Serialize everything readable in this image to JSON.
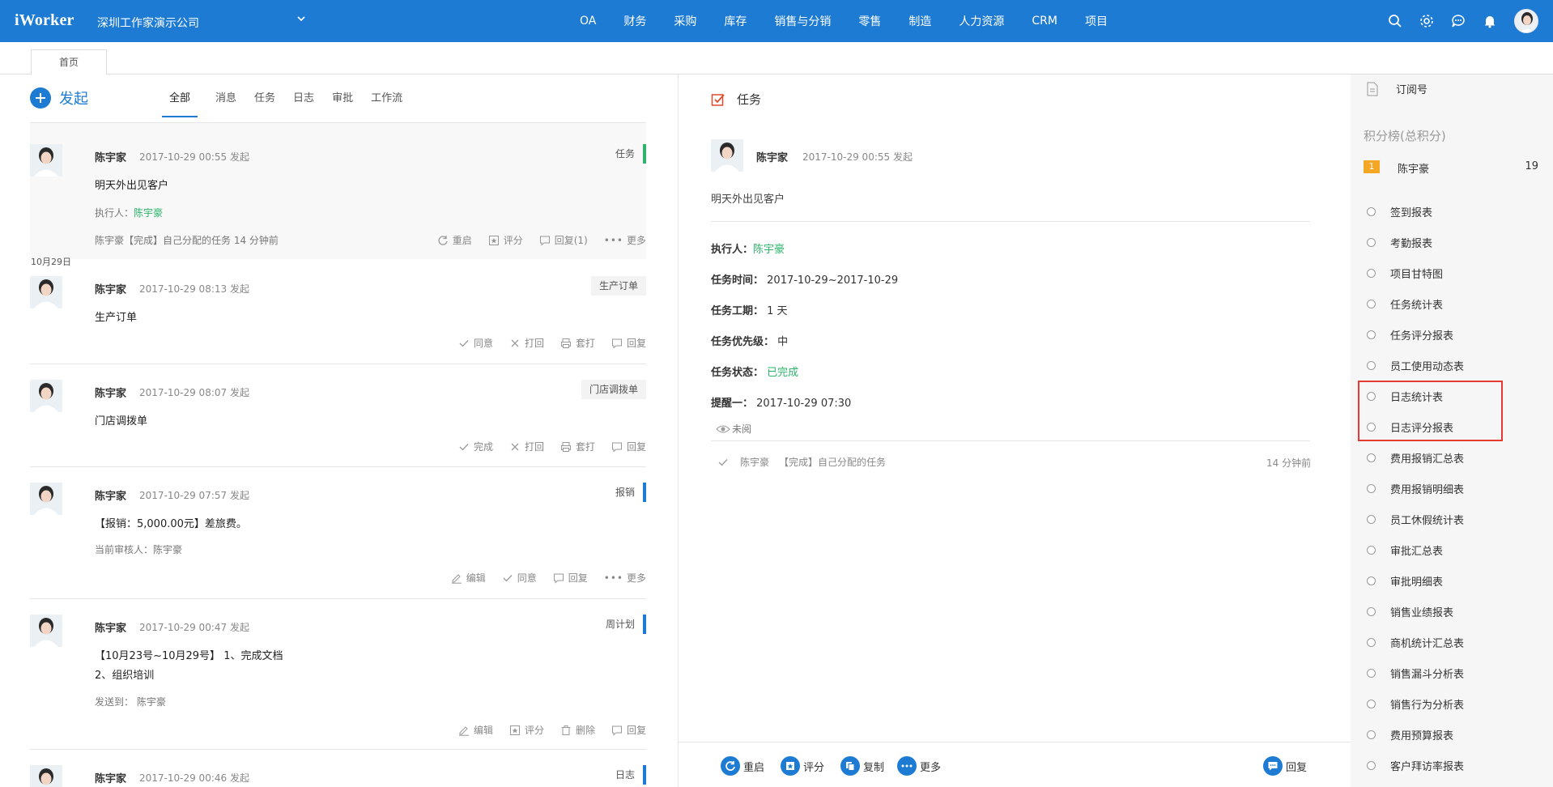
{
  "app": {
    "logo": "iWorker",
    "company": "深圳工作家演示公司"
  },
  "nav": [
    "OA",
    "财务",
    "采购",
    "库存",
    "销售与分销",
    "零售",
    "制造",
    "人力资源",
    "CRM",
    "项目"
  ],
  "top_icons": [
    "search-icon",
    "gear-icon",
    "chat-icon",
    "bell-icon",
    "user-avatar"
  ],
  "tabs": {
    "home": "首页"
  },
  "compose": {
    "label": "发起"
  },
  "feed_tabs": [
    "全部",
    "消息",
    "任务",
    "日志",
    "审批",
    "工作流"
  ],
  "date_label": "10月29日",
  "feed": [
    {
      "name": "陈宇家",
      "time": "2017-10-29 00:55 发起",
      "type": "任务",
      "content": "明天外出见客户",
      "executor_label": "执行人：",
      "executor": "陈宇豪",
      "log": "陈宇豪【完成】自己分配的任务   14 分钟前",
      "actions": [
        "重启",
        "评分",
        "回复(1)",
        "更多"
      ]
    },
    {
      "name": "陈宇家",
      "time": "2017-10-29 08:13 发起",
      "type": "生产订单",
      "content": "生产订单",
      "actions": [
        "同意",
        "打回",
        "套打",
        "回复"
      ]
    },
    {
      "name": "陈宇家",
      "time": "2017-10-29 08:07 发起",
      "type": "门店调拨单",
      "content": "门店调拨单",
      "actions": [
        "完成",
        "打回",
        "套打",
        "回复"
      ]
    },
    {
      "name": "陈宇家",
      "time": "2017-10-29 07:57 发起",
      "type": "报销",
      "content": "【报销：5,000.00元】差旅费。",
      "meta": "当前审核人：陈宇豪",
      "actions": [
        "编辑",
        "同意",
        "回复",
        "更多"
      ]
    },
    {
      "name": "陈宇家",
      "time": "2017-10-29 00:47 发起",
      "type": "周计划",
      "content": "【10月23号~10月29号】 1、完成文档",
      "content2": "2、组织培训",
      "meta": "发送到： 陈宇豪",
      "actions": [
        "编辑",
        "评分",
        "删除",
        "回复"
      ]
    },
    {
      "name": "陈宇家",
      "time": "2017-10-29 00:46 发起",
      "type": "日志"
    }
  ],
  "detail": {
    "header": "任务",
    "name": "陈宇家",
    "time": "2017-10-29 00:55 发起",
    "desc": "明天外出见客户",
    "executor_label": "执行人：",
    "executor": "陈宇豪",
    "task_time_label": "任务时间：",
    "task_time": "2017-10-29~2017-10-29",
    "duration_label": "任务工期：",
    "duration": "1 天",
    "priority_label": "任务优先级：",
    "priority": "中",
    "status_label": "任务状态：",
    "status": "已完成",
    "reminder_label": "提醒一：",
    "reminder": "2017-10-29 07:30",
    "unread": "未阅",
    "log_user": "陈宇豪",
    "log_text": "【完成】自己分配的任务",
    "log_time": "14 分钟前",
    "buttons": [
      "重启",
      "评分",
      "复制",
      "更多"
    ],
    "reply": "回复"
  },
  "sidebar": {
    "subscription": "订阅号",
    "rank_title": "积分榜(总积分)",
    "rank": {
      "pos": "1",
      "name": "陈宇豪",
      "score": "19"
    },
    "reports": [
      "签到报表",
      "考勤报表",
      "项目甘特图",
      "任务统计表",
      "任务评分报表",
      "员工使用动态表",
      "日志统计表",
      "日志评分报表",
      "费用报销汇总表",
      "费用报销明细表",
      "员工休假统计表",
      "审批汇总表",
      "审批明细表",
      "销售业绩报表",
      "商机统计汇总表",
      "销售漏斗分析表",
      "销售行为分析表",
      "费用预算报表",
      "客户拜访率报表"
    ]
  },
  "colors": {
    "brand": "#1d7bd4",
    "green": "#2db36b",
    "highlight": "#e53935",
    "rank_badge": "#f5a623"
  }
}
